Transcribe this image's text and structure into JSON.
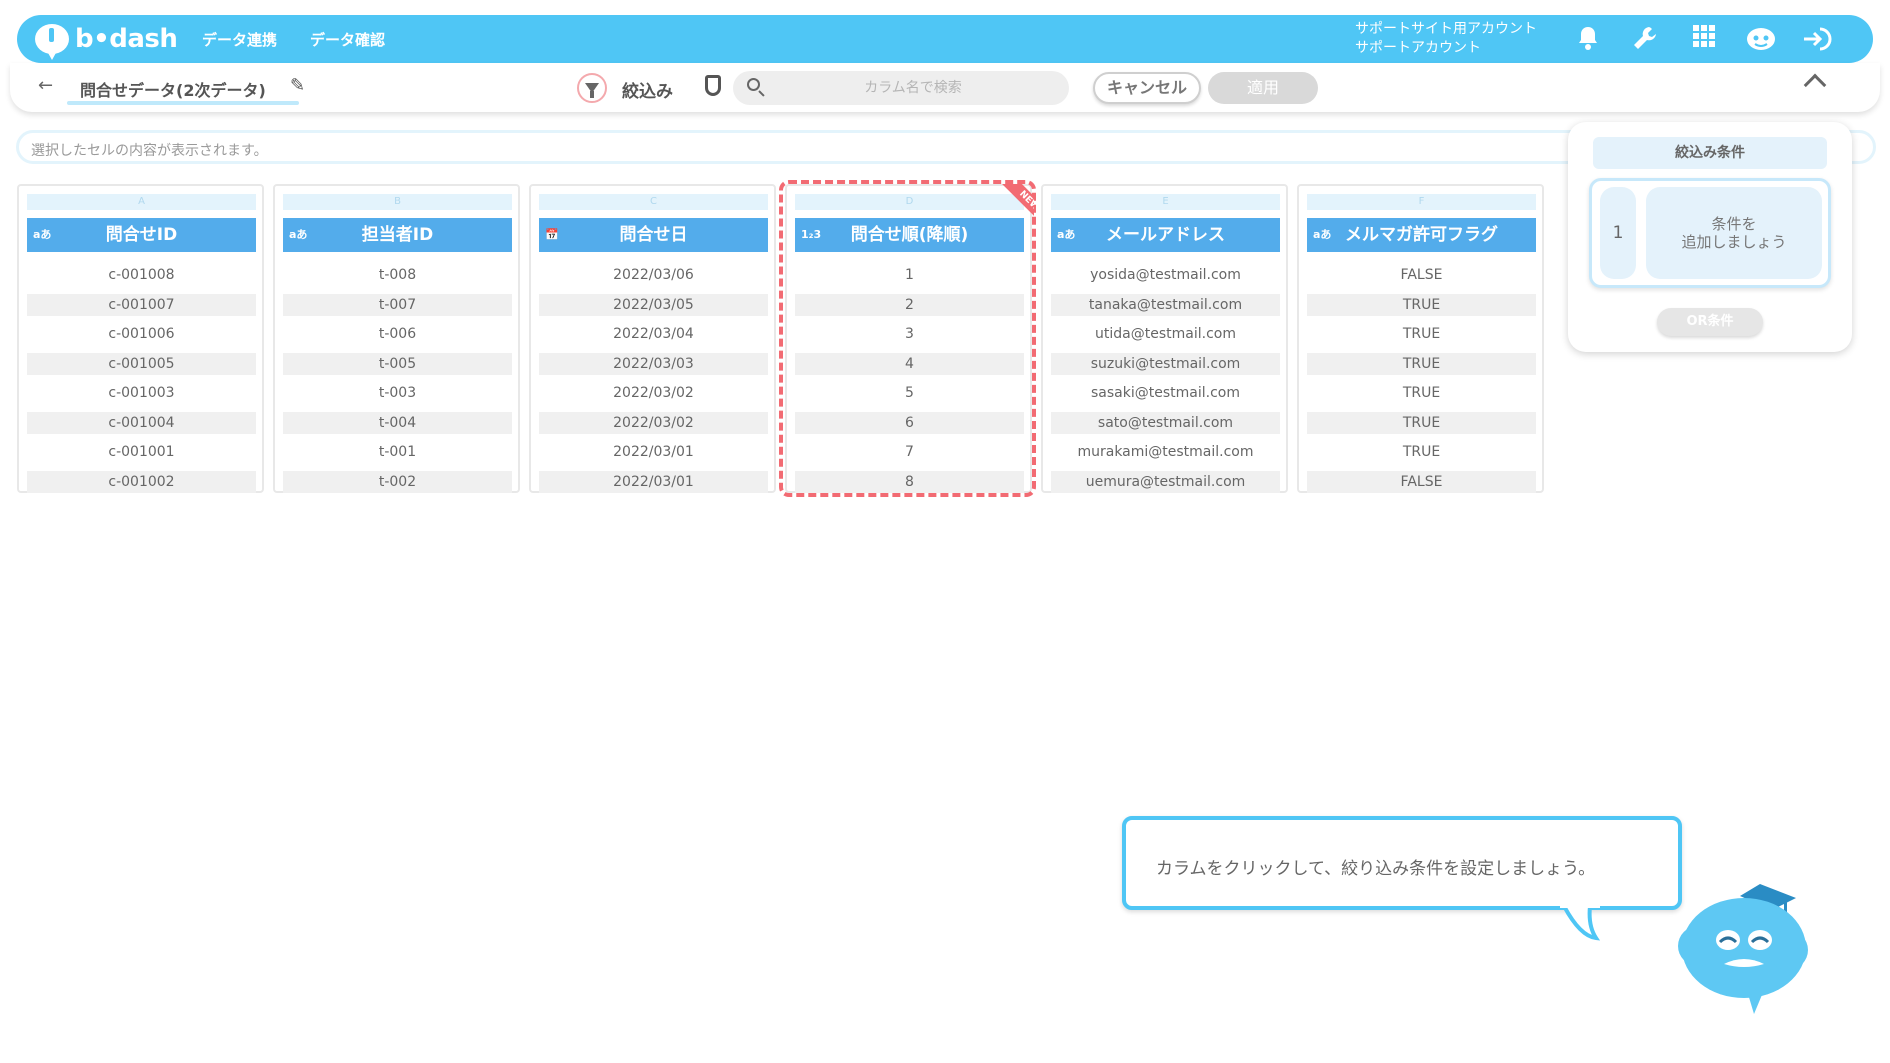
{
  "header": {
    "logo_text": "b•dash",
    "nav": [
      "データ連携",
      "データ確認"
    ],
    "account_line1": "サポートサイト用アカウント",
    "account_line2": "サポートアカウント",
    "icons": [
      "bell-icon",
      "wrench-icon",
      "grid-icon",
      "mascot-icon",
      "logout-icon"
    ]
  },
  "subbar": {
    "back_icon": "arrow-left-icon",
    "breadcrumb": "問合せデータ(2次データ)",
    "filter_label": "絞込み",
    "search_placeholder": "カラム名で検索",
    "cancel_label": "キャンセル",
    "apply_label": "適用"
  },
  "cellbar": {
    "placeholder": "選択したセルの内容が表示されます。"
  },
  "table": {
    "columns": [
      {
        "letter": "A",
        "type": "aあ",
        "header": "問合せID",
        "values": [
          "c-001008",
          "c-001007",
          "c-001006",
          "c-001005",
          "c-001003",
          "c-001004",
          "c-001001",
          "c-001002"
        ]
      },
      {
        "letter": "B",
        "type": "aあ",
        "header": "担当者ID",
        "values": [
          "t-008",
          "t-007",
          "t-006",
          "t-005",
          "t-003",
          "t-004",
          "t-001",
          "t-002"
        ]
      },
      {
        "letter": "C",
        "type": "📅",
        "header": "問合せ日",
        "values": [
          "2022/03/06",
          "2022/03/05",
          "2022/03/04",
          "2022/03/03",
          "2022/03/02",
          "2022/03/02",
          "2022/03/01",
          "2022/03/01"
        ]
      },
      {
        "letter": "D",
        "type": "1₂3",
        "header": "問合せ順(降順)",
        "values": [
          "1",
          "2",
          "3",
          "4",
          "5",
          "6",
          "7",
          "8"
        ]
      },
      {
        "letter": "E",
        "type": "aあ",
        "header": "メールアドレス",
        "values": [
          "yosida@testmail.com",
          "tanaka@testmail.com",
          "utida@testmail.com",
          "suzuki@testmail.com",
          "sasaki@testmail.com",
          "sato@testmail.com",
          "murakami@testmail.com",
          "uemura@testmail.com"
        ]
      },
      {
        "letter": "F",
        "type": "aあ",
        "header": "メルマガ許可フラグ",
        "values": [
          "FALSE",
          "TRUE",
          "TRUE",
          "TRUE",
          "TRUE",
          "TRUE",
          "TRUE",
          "FALSE"
        ]
      }
    ],
    "new_badge": "NEW"
  },
  "filter_panel": {
    "title": "絞込み条件",
    "group_number": "1",
    "add_line1": "条件を",
    "add_line2": "追加しましょう",
    "or_label": "OR条件"
  },
  "tip": {
    "text": "カラムをクリックして、絞り込み条件を設定しましょう。"
  },
  "colors": {
    "brand": "#4fc6f5",
    "header_cell": "#53aceb",
    "highlight": "#f26b73"
  }
}
